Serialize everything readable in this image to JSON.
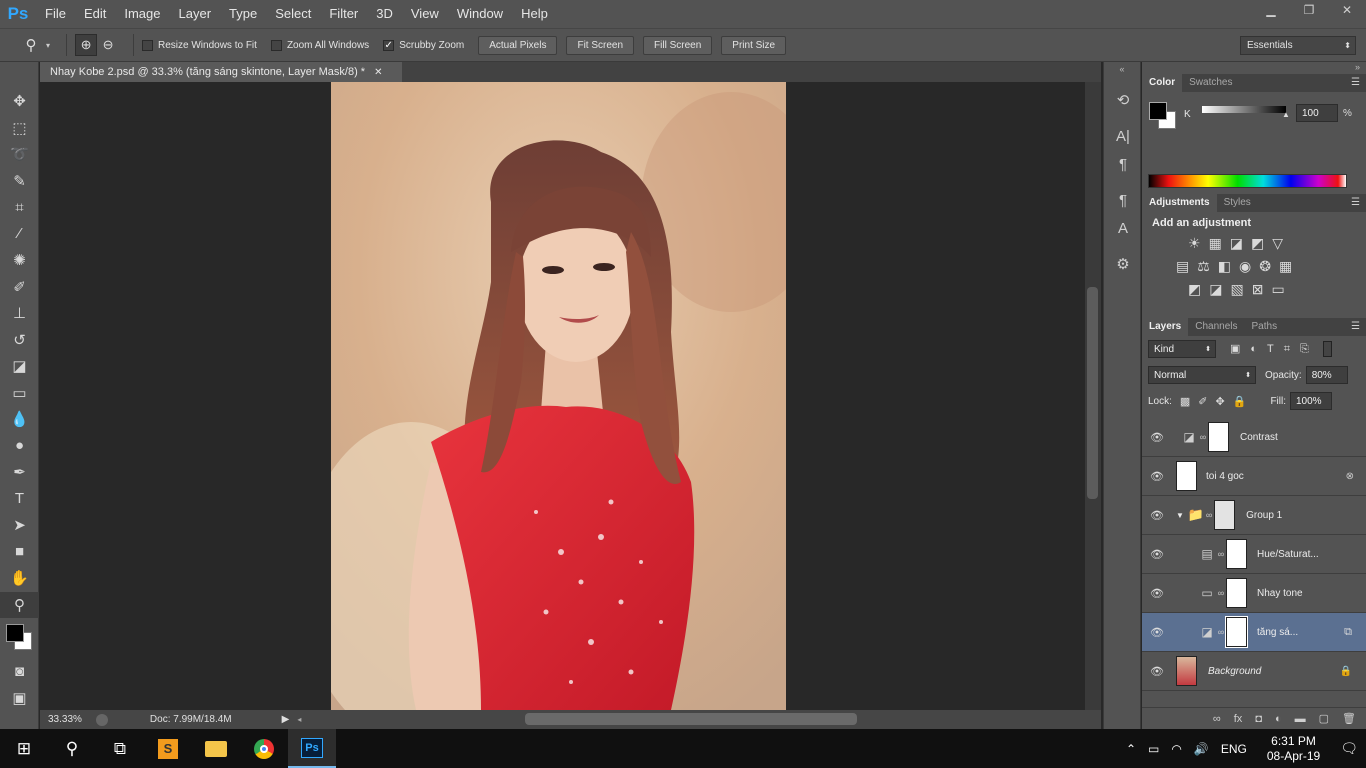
{
  "app": {
    "logo": "Ps"
  },
  "menu": [
    "File",
    "Edit",
    "Image",
    "Layer",
    "Type",
    "Select",
    "Filter",
    "3D",
    "View",
    "Window",
    "Help"
  ],
  "window_controls": {
    "minimize": "▁",
    "restore": "❐",
    "close": "✕"
  },
  "options": {
    "resize_windows": "Resize Windows to Fit",
    "zoom_all": "Zoom All Windows",
    "scrubby_zoom": "Scrubby Zoom",
    "actual_pixels": "Actual Pixels",
    "fit_screen": "Fit Screen",
    "fill_screen": "Fill Screen",
    "print_size": "Print Size",
    "workspace": "Essentials"
  },
  "document": {
    "tab_title": "Nhay Kobe 2.psd @ 33.3% (tăng sáng skintone, Layer Mask/8) *",
    "zoom": "33.33%",
    "doc_info": "Doc: 7.99M/18.4M"
  },
  "color_panel": {
    "tabs": [
      "Color",
      "Swatches"
    ],
    "channel": "K",
    "value": "100",
    "unit": "%"
  },
  "adjustments_panel": {
    "tabs": [
      "Adjustments",
      "Styles"
    ],
    "heading": "Add an adjustment"
  },
  "layers_panel": {
    "tabs": [
      "Layers",
      "Channels",
      "Paths"
    ],
    "filter_kind": "Kind",
    "blend_mode": "Normal",
    "opacity_label": "Opacity:",
    "opacity": "80%",
    "lock_label": "Lock:",
    "fill_label": "Fill:",
    "fill": "100%",
    "layers": [
      {
        "name": "Contrast"
      },
      {
        "name": "toi 4 goc"
      },
      {
        "name": "Group 1"
      },
      {
        "name": "Hue/Saturat..."
      },
      {
        "name": "Nhay tone"
      },
      {
        "name": "tăng sá..."
      },
      {
        "name": "Background"
      }
    ]
  },
  "taskbar": {
    "time": "6:31 PM",
    "date": "08-Apr-19",
    "lang": "ENG"
  }
}
